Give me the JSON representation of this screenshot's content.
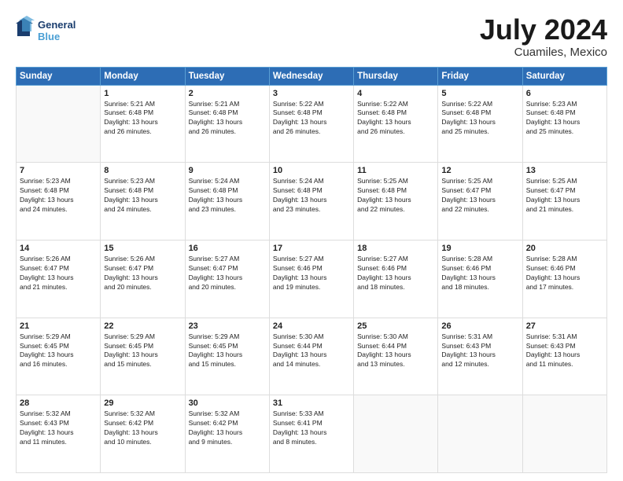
{
  "header": {
    "logo_line1": "General",
    "logo_line2": "Blue",
    "month": "July 2024",
    "location": "Cuamiles, Mexico"
  },
  "days_of_week": [
    "Sunday",
    "Monday",
    "Tuesday",
    "Wednesday",
    "Thursday",
    "Friday",
    "Saturday"
  ],
  "weeks": [
    [
      {
        "day": "",
        "info": ""
      },
      {
        "day": "1",
        "info": "Sunrise: 5:21 AM\nSunset: 6:48 PM\nDaylight: 13 hours\nand 26 minutes."
      },
      {
        "day": "2",
        "info": "Sunrise: 5:21 AM\nSunset: 6:48 PM\nDaylight: 13 hours\nand 26 minutes."
      },
      {
        "day": "3",
        "info": "Sunrise: 5:22 AM\nSunset: 6:48 PM\nDaylight: 13 hours\nand 26 minutes."
      },
      {
        "day": "4",
        "info": "Sunrise: 5:22 AM\nSunset: 6:48 PM\nDaylight: 13 hours\nand 26 minutes."
      },
      {
        "day": "5",
        "info": "Sunrise: 5:22 AM\nSunset: 6:48 PM\nDaylight: 13 hours\nand 25 minutes."
      },
      {
        "day": "6",
        "info": "Sunrise: 5:23 AM\nSunset: 6:48 PM\nDaylight: 13 hours\nand 25 minutes."
      }
    ],
    [
      {
        "day": "7",
        "info": "Sunrise: 5:23 AM\nSunset: 6:48 PM\nDaylight: 13 hours\nand 24 minutes."
      },
      {
        "day": "8",
        "info": "Sunrise: 5:23 AM\nSunset: 6:48 PM\nDaylight: 13 hours\nand 24 minutes."
      },
      {
        "day": "9",
        "info": "Sunrise: 5:24 AM\nSunset: 6:48 PM\nDaylight: 13 hours\nand 23 minutes."
      },
      {
        "day": "10",
        "info": "Sunrise: 5:24 AM\nSunset: 6:48 PM\nDaylight: 13 hours\nand 23 minutes."
      },
      {
        "day": "11",
        "info": "Sunrise: 5:25 AM\nSunset: 6:48 PM\nDaylight: 13 hours\nand 22 minutes."
      },
      {
        "day": "12",
        "info": "Sunrise: 5:25 AM\nSunset: 6:47 PM\nDaylight: 13 hours\nand 22 minutes."
      },
      {
        "day": "13",
        "info": "Sunrise: 5:25 AM\nSunset: 6:47 PM\nDaylight: 13 hours\nand 21 minutes."
      }
    ],
    [
      {
        "day": "14",
        "info": "Sunrise: 5:26 AM\nSunset: 6:47 PM\nDaylight: 13 hours\nand 21 minutes."
      },
      {
        "day": "15",
        "info": "Sunrise: 5:26 AM\nSunset: 6:47 PM\nDaylight: 13 hours\nand 20 minutes."
      },
      {
        "day": "16",
        "info": "Sunrise: 5:27 AM\nSunset: 6:47 PM\nDaylight: 13 hours\nand 20 minutes."
      },
      {
        "day": "17",
        "info": "Sunrise: 5:27 AM\nSunset: 6:46 PM\nDaylight: 13 hours\nand 19 minutes."
      },
      {
        "day": "18",
        "info": "Sunrise: 5:27 AM\nSunset: 6:46 PM\nDaylight: 13 hours\nand 18 minutes."
      },
      {
        "day": "19",
        "info": "Sunrise: 5:28 AM\nSunset: 6:46 PM\nDaylight: 13 hours\nand 18 minutes."
      },
      {
        "day": "20",
        "info": "Sunrise: 5:28 AM\nSunset: 6:46 PM\nDaylight: 13 hours\nand 17 minutes."
      }
    ],
    [
      {
        "day": "21",
        "info": "Sunrise: 5:29 AM\nSunset: 6:45 PM\nDaylight: 13 hours\nand 16 minutes."
      },
      {
        "day": "22",
        "info": "Sunrise: 5:29 AM\nSunset: 6:45 PM\nDaylight: 13 hours\nand 15 minutes."
      },
      {
        "day": "23",
        "info": "Sunrise: 5:29 AM\nSunset: 6:45 PM\nDaylight: 13 hours\nand 15 minutes."
      },
      {
        "day": "24",
        "info": "Sunrise: 5:30 AM\nSunset: 6:44 PM\nDaylight: 13 hours\nand 14 minutes."
      },
      {
        "day": "25",
        "info": "Sunrise: 5:30 AM\nSunset: 6:44 PM\nDaylight: 13 hours\nand 13 minutes."
      },
      {
        "day": "26",
        "info": "Sunrise: 5:31 AM\nSunset: 6:43 PM\nDaylight: 13 hours\nand 12 minutes."
      },
      {
        "day": "27",
        "info": "Sunrise: 5:31 AM\nSunset: 6:43 PM\nDaylight: 13 hours\nand 11 minutes."
      }
    ],
    [
      {
        "day": "28",
        "info": "Sunrise: 5:32 AM\nSunset: 6:43 PM\nDaylight: 13 hours\nand 11 minutes."
      },
      {
        "day": "29",
        "info": "Sunrise: 5:32 AM\nSunset: 6:42 PM\nDaylight: 13 hours\nand 10 minutes."
      },
      {
        "day": "30",
        "info": "Sunrise: 5:32 AM\nSunset: 6:42 PM\nDaylight: 13 hours\nand 9 minutes."
      },
      {
        "day": "31",
        "info": "Sunrise: 5:33 AM\nSunset: 6:41 PM\nDaylight: 13 hours\nand 8 minutes."
      },
      {
        "day": "",
        "info": ""
      },
      {
        "day": "",
        "info": ""
      },
      {
        "day": "",
        "info": ""
      }
    ]
  ]
}
